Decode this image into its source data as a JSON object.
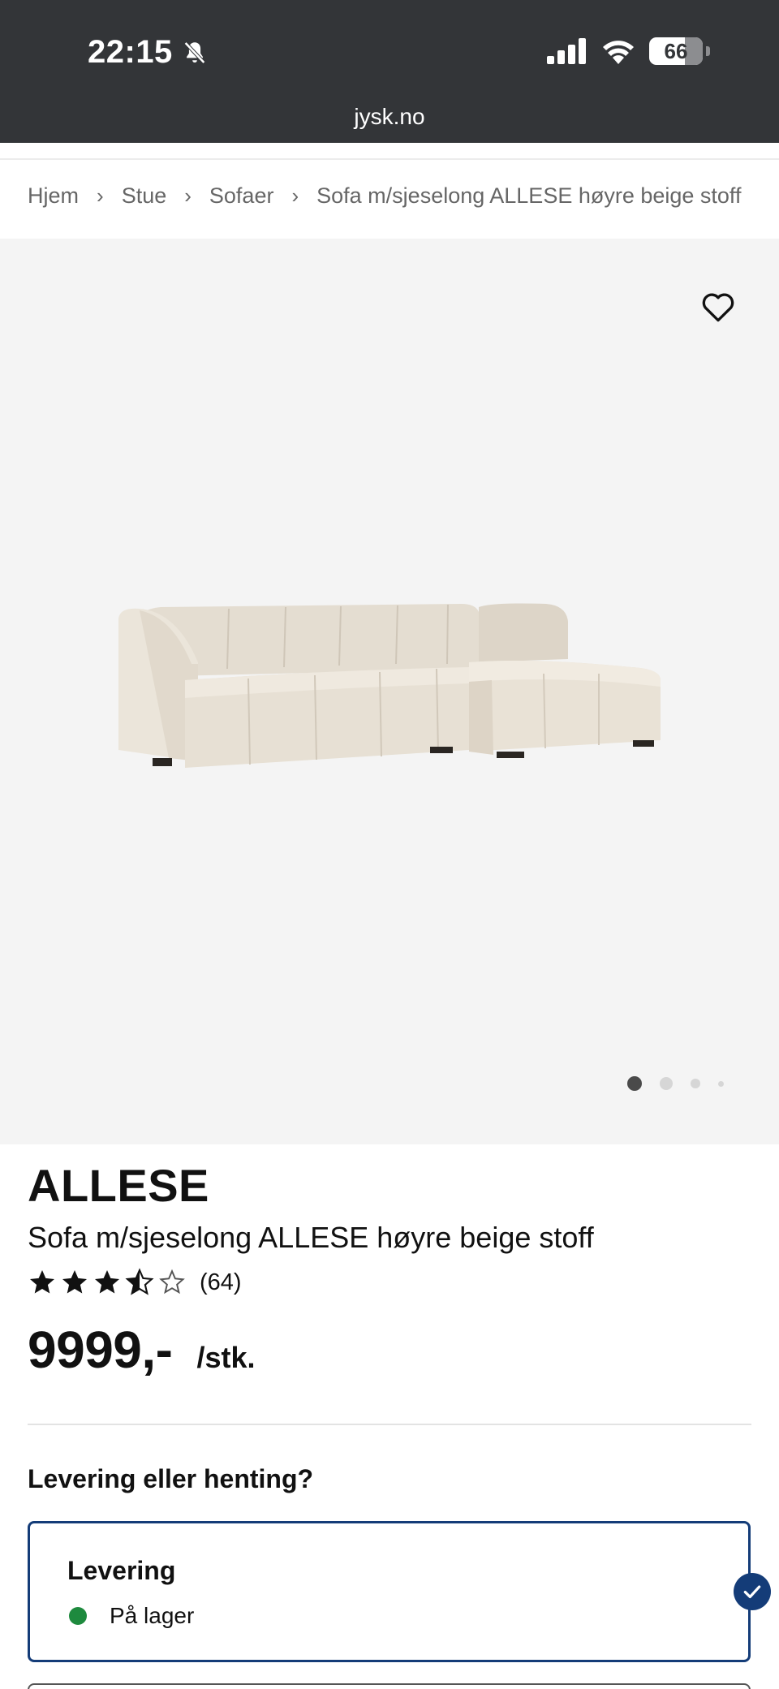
{
  "status_bar": {
    "time": "22:15",
    "battery": "66"
  },
  "browser": {
    "url": "jysk.no"
  },
  "breadcrumb": [
    "Hjem",
    "Stue",
    "Sofaer",
    "Sofa m/sjeselong ALLESE høyre beige stoff"
  ],
  "gallery": {
    "image_count": 4,
    "active_index": 0
  },
  "product": {
    "brand": "ALLESE",
    "title": "Sofa m/sjeselong ALLESE høyre beige stoff",
    "rating": 3.5,
    "rating_max": 5,
    "review_count": "(64)",
    "price": "9999,-",
    "unit": "/stk."
  },
  "delivery": {
    "heading": "Levering eller henting?",
    "option_label": "Levering",
    "stock_status": "På lager",
    "selected": true
  },
  "colors": {
    "chrome": "#333538",
    "accent": "#143c78",
    "in_stock": "#1e8a3e"
  }
}
